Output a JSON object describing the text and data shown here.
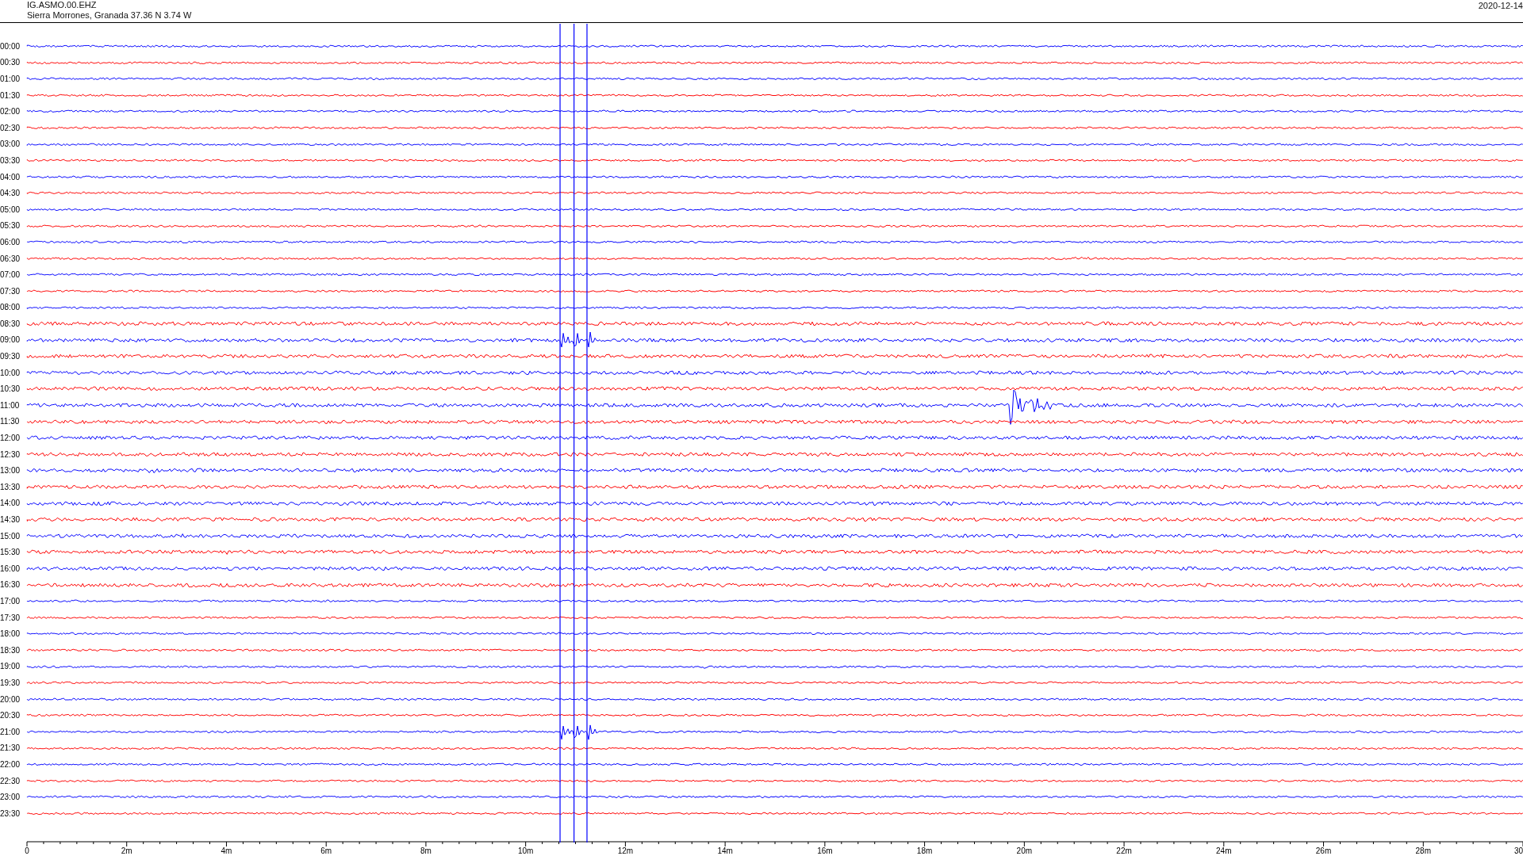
{
  "header": {
    "station": "IG.ASMO.00.EHZ",
    "location": "Sierra Morrones, Granada  37.36 N 3.74 W",
    "date": "2020-12-14"
  },
  "traces": [
    {
      "label": "00:00",
      "color": "#0000ff"
    },
    {
      "label": "00:30",
      "color": "#ff0000"
    },
    {
      "label": "01:00",
      "color": "#0000ff"
    },
    {
      "label": "01:30",
      "color": "#ff0000"
    },
    {
      "label": "02:00",
      "color": "#0000ff"
    },
    {
      "label": "02:30",
      "color": "#ff0000"
    },
    {
      "label": "03:00",
      "color": "#0000ff"
    },
    {
      "label": "03:30",
      "color": "#ff0000"
    },
    {
      "label": "04:00",
      "color": "#0000ff"
    },
    {
      "label": "04:30",
      "color": "#ff0000"
    },
    {
      "label": "05:00",
      "color": "#0000ff"
    },
    {
      "label": "05:30",
      "color": "#ff0000"
    },
    {
      "label": "06:00",
      "color": "#0000ff"
    },
    {
      "label": "06:30",
      "color": "#ff0000"
    },
    {
      "label": "07:00",
      "color": "#0000ff"
    },
    {
      "label": "07:30",
      "color": "#ff0000"
    },
    {
      "label": "08:00",
      "color": "#0000ff"
    },
    {
      "label": "08:30",
      "color": "#ff0000"
    },
    {
      "label": "09:00",
      "color": "#0000ff"
    },
    {
      "label": "09:30",
      "color": "#ff0000"
    },
    {
      "label": "10:00",
      "color": "#0000ff"
    },
    {
      "label": "10:30",
      "color": "#ff0000"
    },
    {
      "label": "11:00",
      "color": "#0000ff"
    },
    {
      "label": "11:30",
      "color": "#ff0000"
    },
    {
      "label": "12:00",
      "color": "#0000ff"
    },
    {
      "label": "12:30",
      "color": "#ff0000"
    },
    {
      "label": "13:00",
      "color": "#0000ff"
    },
    {
      "label": "13:30",
      "color": "#ff0000"
    },
    {
      "label": "14:00",
      "color": "#0000ff"
    },
    {
      "label": "14:30",
      "color": "#ff0000"
    },
    {
      "label": "15:00",
      "color": "#0000ff"
    },
    {
      "label": "15:30",
      "color": "#ff0000"
    },
    {
      "label": "16:00",
      "color": "#0000ff"
    },
    {
      "label": "16:30",
      "color": "#ff0000"
    },
    {
      "label": "17:00",
      "color": "#0000ff"
    },
    {
      "label": "17:30",
      "color": "#ff0000"
    },
    {
      "label": "18:00",
      "color": "#0000ff"
    },
    {
      "label": "18:30",
      "color": "#ff0000"
    },
    {
      "label": "19:00",
      "color": "#0000ff"
    },
    {
      "label": "19:30",
      "color": "#ff0000"
    },
    {
      "label": "20:00",
      "color": "#0000ff"
    },
    {
      "label": "20:30",
      "color": "#ff0000"
    },
    {
      "label": "21:00",
      "color": "#0000ff"
    },
    {
      "label": "21:30",
      "color": "#ff0000"
    },
    {
      "label": "22:00",
      "color": "#0000ff"
    },
    {
      "label": "22:30",
      "color": "#ff0000"
    },
    {
      "label": "23:00",
      "color": "#0000ff"
    },
    {
      "label": "23:30",
      "color": "#ff0000"
    }
  ],
  "x_axis": {
    "ticks": [
      "0",
      "2m",
      "4m",
      "6m",
      "8m",
      "10m",
      "12m",
      "14m",
      "16m",
      "18m",
      "20m",
      "22m",
      "24m",
      "26m",
      "28m",
      "30"
    ]
  }
}
